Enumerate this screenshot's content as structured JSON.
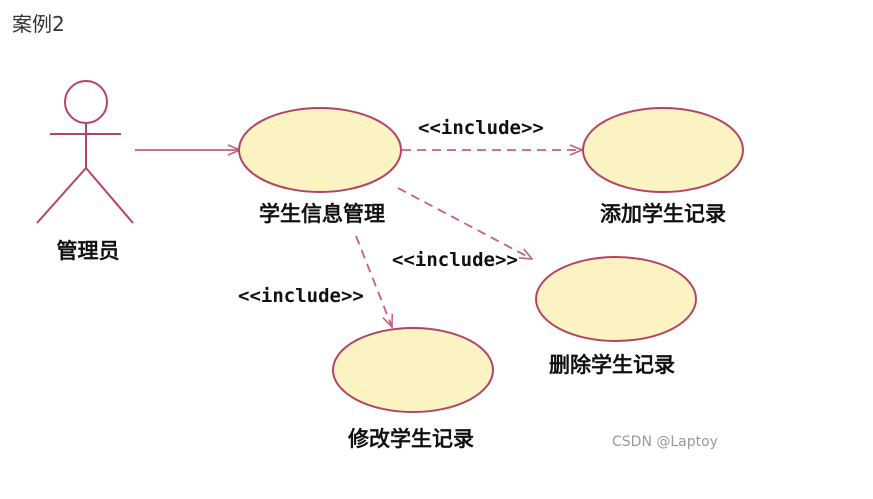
{
  "title": "案例2",
  "colors": {
    "use_case_fill": "#fbf3c1",
    "outline": "#b34465",
    "line": "#c5607b"
  },
  "actor": {
    "label": "管理员"
  },
  "use_cases": {
    "main": "学生信息管理",
    "add": "添加学生记录",
    "delete": "删除学生记录",
    "modify": "修改学生记录"
  },
  "relations": {
    "include_add": "<<include>>",
    "include_delete": "<<include>>",
    "include_modify": "<<include>>"
  },
  "watermark": "CSDN @Laptoy"
}
